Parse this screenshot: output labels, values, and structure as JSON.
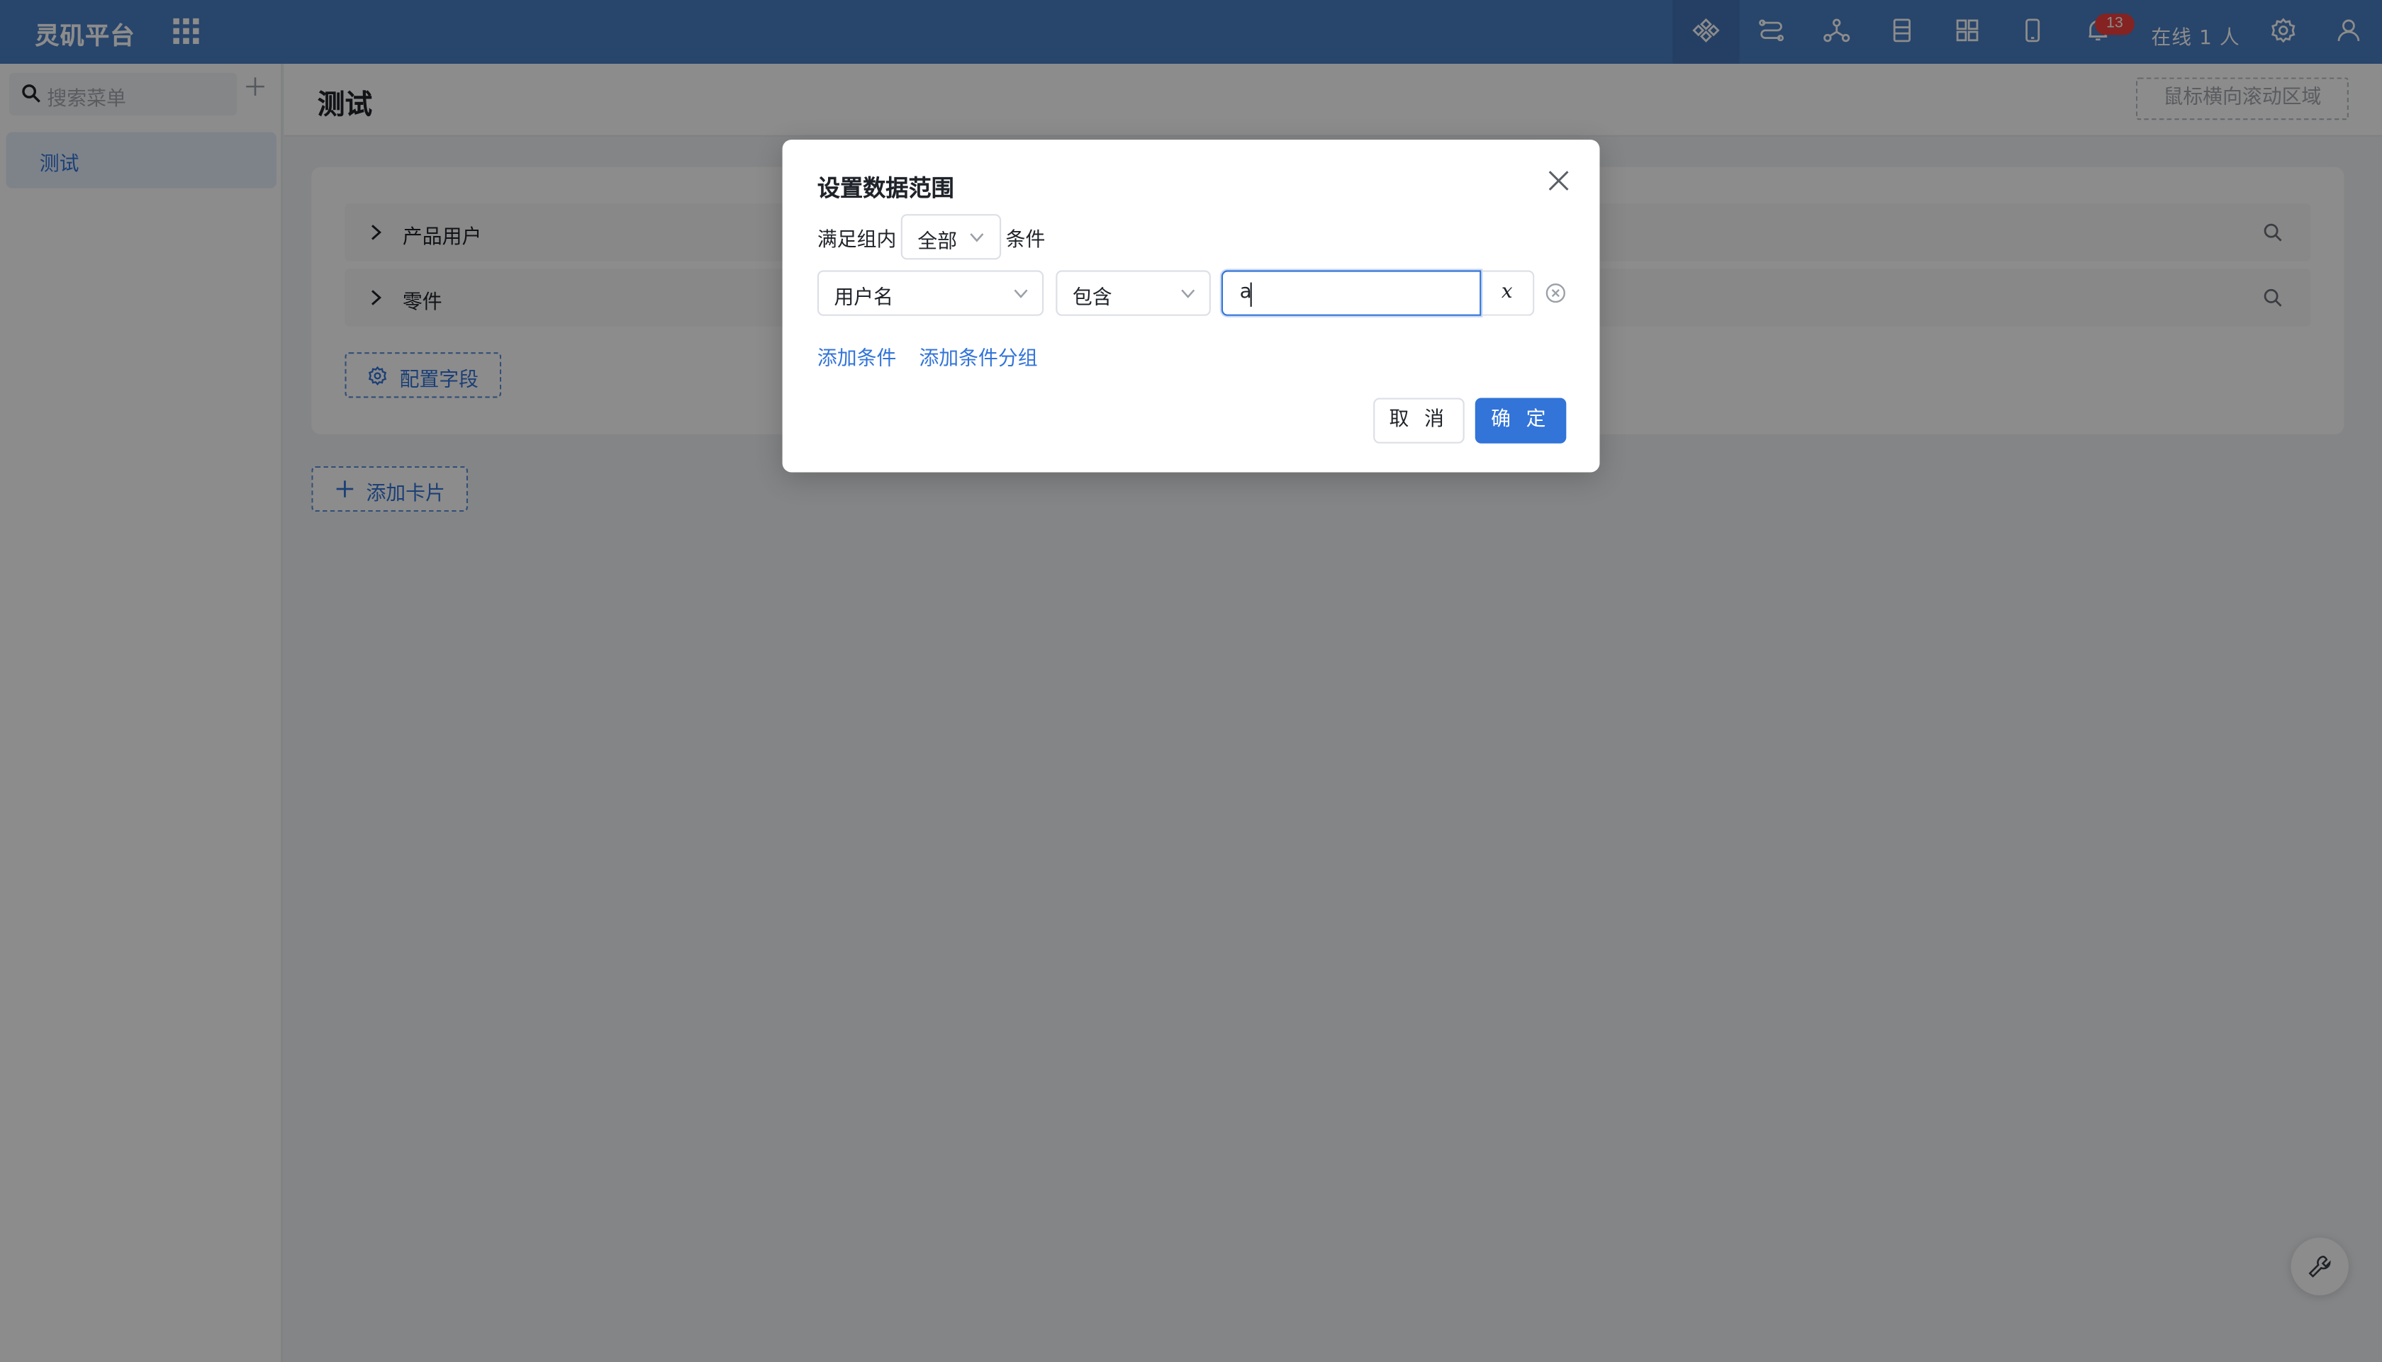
{
  "header": {
    "brand": "灵矶平台",
    "notification_count": "13",
    "online_text": "在线 1 人",
    "icons": [
      "apps-grid-icon",
      "component-icon",
      "route-icon",
      "network-icon",
      "document-icon",
      "layout-icon",
      "mobile-icon",
      "bell-icon",
      "gear-icon",
      "user-icon"
    ]
  },
  "sidebar": {
    "search_placeholder": "搜索菜单",
    "items": [
      {
        "label": "测试",
        "active": true
      }
    ]
  },
  "main": {
    "title": "测试",
    "scroll_hint": "鼠标横向滚动区域",
    "card": {
      "rows": [
        {
          "label": "产品用户"
        },
        {
          "label": "零件"
        }
      ],
      "config_button": "配置字段"
    },
    "add_card_button": "添加卡片"
  },
  "dialog": {
    "title": "设置数据范围",
    "match_prefix": "满足组内",
    "match_value": "全部",
    "match_suffix": "条件",
    "condition": {
      "field": "用户名",
      "operator": "包含",
      "value": "a",
      "fx_label": "x"
    },
    "add_condition": "添加条件",
    "add_condition_group": "添加条件分组",
    "cancel": "取 消",
    "confirm": "确 定"
  },
  "colors": {
    "header_bg": "#4a7ec4",
    "accent": "#3274d8",
    "badge": "#f0413e",
    "overlay": "rgba(0,0,0,0.45)"
  }
}
